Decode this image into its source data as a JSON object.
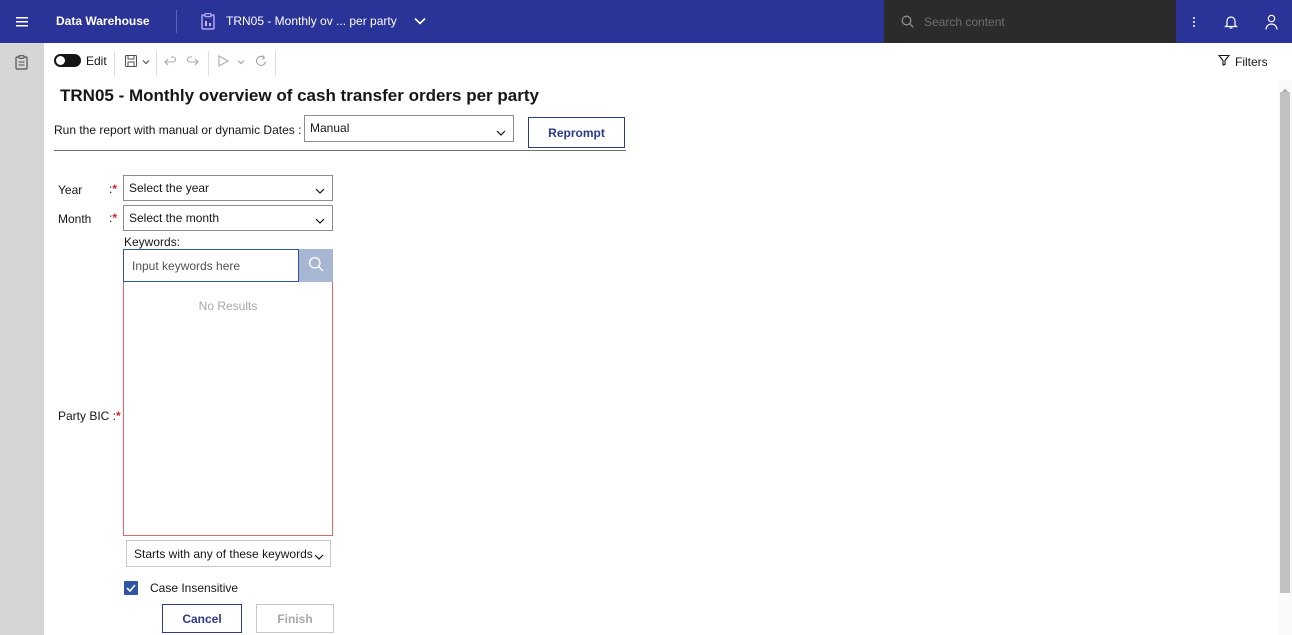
{
  "header": {
    "app_title": "Data Warehouse",
    "doc_title": "TRN05 - Monthly ov ... per party",
    "search_placeholder": "Search content"
  },
  "toolbar": {
    "edit_label": "Edit",
    "filters_label": "Filters"
  },
  "report": {
    "title": "TRN05 - Monthly overview of cash transfer orders per party",
    "dates_label": "Run the report with manual or dynamic Dates :",
    "dates_value": "Manual",
    "reprompt_label": "Reprompt"
  },
  "prompts": {
    "year_label": "Year",
    "year_colon": ":",
    "year_value": "Select the year",
    "month_label": "Month",
    "month_colon": ":",
    "month_value": "Select the month",
    "required_mark": "*",
    "party_label": "Party BIC :",
    "keywords_label": "Keywords:",
    "keywords_placeholder": "Input keywords here",
    "no_results": "No Results",
    "match_mode": "Starts with any of these keywords",
    "case_insensitive_label": "Case Insensitive",
    "case_insensitive_checked": true
  },
  "actions": {
    "cancel_label": "Cancel",
    "finish_label": "Finish"
  },
  "colors": {
    "header_bg": "#2a3398",
    "accent": "#2d3a8c",
    "required": "#da1e28"
  }
}
